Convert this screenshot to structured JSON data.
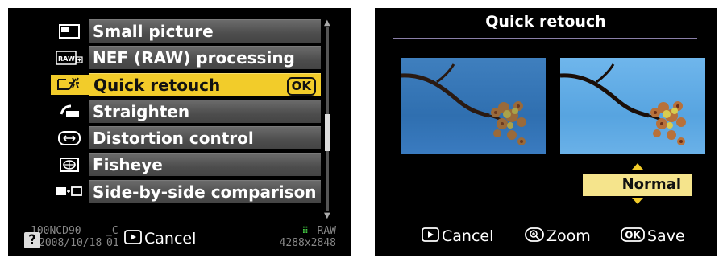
{
  "menu": {
    "items": [
      {
        "label": "Small picture",
        "icon": "small-picture-icon"
      },
      {
        "label": "NEF (RAW) processing",
        "icon": "raw-processing-icon"
      },
      {
        "label": "Quick retouch",
        "icon": "quick-retouch-icon",
        "badge": "OK"
      },
      {
        "label": "Straighten",
        "icon": "straighten-icon"
      },
      {
        "label": "Distortion control",
        "icon": "distortion-control-icon"
      },
      {
        "label": "Fisheye",
        "icon": "fisheye-icon"
      },
      {
        "label": "Side-by-side comparison",
        "icon": "side-by-side-icon"
      }
    ],
    "selected_index": 2
  },
  "left_footer": {
    "help": "?",
    "folder": "100NCD90",
    "date": "2008/10/18",
    "suffix_c": "_C",
    "suffix_01": "01",
    "cancel_label": "Cancel",
    "format": "RAW",
    "resolution": "4288x2848"
  },
  "retouch": {
    "title": "Quick retouch",
    "level": "Normal",
    "cancel_label": "Cancel",
    "zoom_label": "Zoom",
    "save_label": "Save"
  },
  "colors": {
    "highlight": "#f2cc2a",
    "level_box": "#f5e48c",
    "divider": "#8a7fa8"
  }
}
